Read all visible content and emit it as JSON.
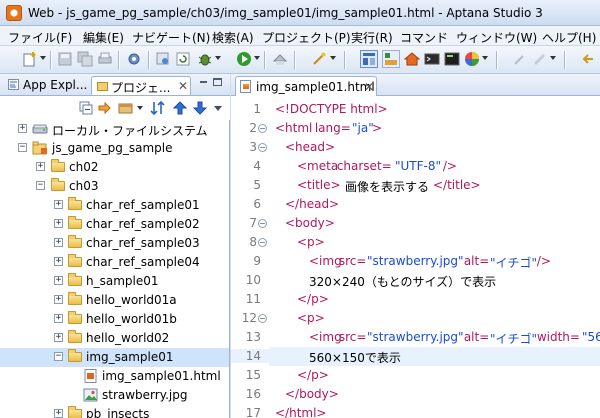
{
  "window": {
    "title": "Web - js_game_pg_sample/ch03/img_sample01/img_sample01.html - Aptana Studio 3"
  },
  "menubar": {
    "items": [
      "ファイル(F)",
      "編集(E)",
      "ナビゲート(N)",
      "検索(A)",
      "プロジェクト(P)",
      "実行(R)",
      "コマンド",
      "ウィンドウ(W)",
      "ヘルプ(H)"
    ]
  },
  "left_pane": {
    "tabs": [
      {
        "label": "App Expl..."
      },
      {
        "label": "プロジェ..."
      }
    ],
    "close_glyph": "✕",
    "tree": [
      {
        "label": "ローカル・ファイルシステム",
        "expander": "+"
      },
      {
        "label": "js_game_pg_sample",
        "expander": "−"
      },
      {
        "label": "ch02",
        "expander": "+"
      },
      {
        "label": "ch03",
        "expander": "−"
      },
      {
        "label": "char_ref_sample01",
        "expander": "+"
      },
      {
        "label": "char_ref_sample02",
        "expander": "+"
      },
      {
        "label": "char_ref_sample03",
        "expander": "+"
      },
      {
        "label": "char_ref_sample04",
        "expander": "+"
      },
      {
        "label": "h_sample01",
        "expander": "+"
      },
      {
        "label": "hello_world01a",
        "expander": "+"
      },
      {
        "label": "hello_world01b",
        "expander": "+"
      },
      {
        "label": "hello_world02",
        "expander": "+"
      },
      {
        "label": "img_sample01",
        "expander": "−"
      },
      {
        "label": "img_sample01.html",
        "expander": ""
      },
      {
        "label": "strawberry.jpg",
        "expander": ""
      },
      {
        "label": "pb_insects",
        "expander": "+"
      }
    ]
  },
  "editor": {
    "tab_label": "img_sample01.html",
    "close_glyph": "✕",
    "lines": [
      {
        "num": "1",
        "fold": ""
      },
      {
        "num": "2",
        "fold": "−"
      },
      {
        "num": "3",
        "fold": "−"
      },
      {
        "num": "4",
        "fold": ""
      },
      {
        "num": "5",
        "fold": ""
      },
      {
        "num": "6",
        "fold": ""
      },
      {
        "num": "7",
        "fold": "−"
      },
      {
        "num": "8",
        "fold": "−"
      },
      {
        "num": "9",
        "fold": ""
      },
      {
        "num": "10",
        "fold": ""
      },
      {
        "num": "11",
        "fold": ""
      },
      {
        "num": "12",
        "fold": "−"
      },
      {
        "num": "13",
        "fold": ""
      },
      {
        "num": "14",
        "fold": ""
      },
      {
        "num": "15",
        "fold": ""
      },
      {
        "num": "16",
        "fold": ""
      },
      {
        "num": "17",
        "fold": ""
      }
    ],
    "code": {
      "l1": "<!DOCTYPE html>",
      "l2_tag": "<html",
      "l2_attr": " lang=",
      "l2_val": "\"ja\"",
      "l2_end": ">",
      "l3": "<head>",
      "l4_tag": "<meta",
      "l4_attr": " charset=",
      "l4_val": "\"UTF-8\"",
      "l4_end": " />",
      "l5_open": "<title>",
      "l5_text": "画像を表示する",
      "l5_close": "</title>",
      "l6": "</head>",
      "l7": "<body>",
      "l8": "<p>",
      "l9_tag": "<img",
      "l9_attr1": " src=",
      "l9_val1": "\"strawberry.jpg\"",
      "l9_attr2": " alt=",
      "l9_val2": "\"イチゴ\"",
      "l9_end": " />",
      "l10": "320×240（もとのサイズ）で表示",
      "l11": "</p>",
      "l12": "<p>",
      "l13_tag": "<img",
      "l13_attr1": " src=",
      "l13_val1": "\"strawberry.jpg\"",
      "l13_attr2": " alt=",
      "l13_val2": "\"イチゴ\"",
      "l13_attr3": " width=",
      "l13_val3": "\"56",
      "l14": "560×150で表示",
      "l15": "</p>",
      "l16": "</body>",
      "l17": "</html>"
    }
  },
  "colors": {
    "tag": "#b0175d",
    "value": "#1a4bd2",
    "selection": "#cfe3fb",
    "current_line": "#e8f2fe"
  }
}
